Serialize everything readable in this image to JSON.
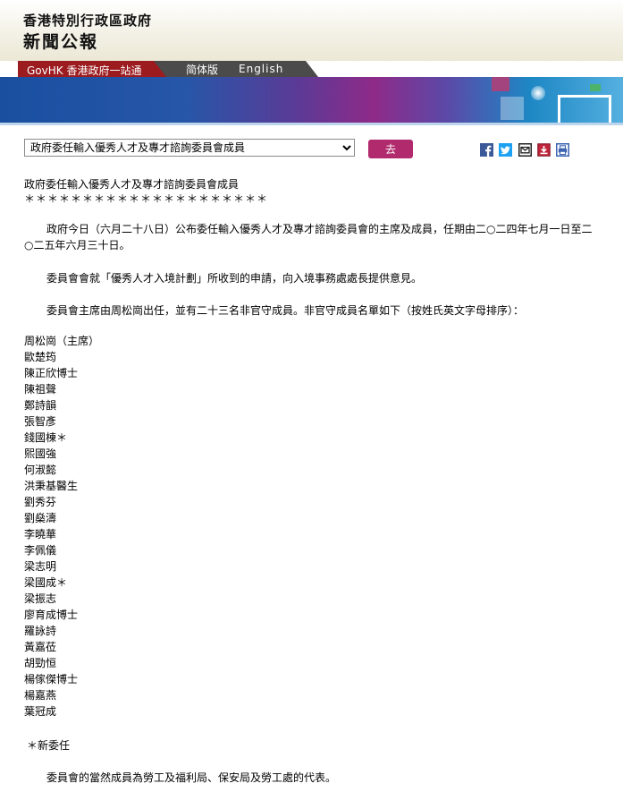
{
  "header": {
    "gov_name": "香港特別行政區政府",
    "press_name": "新聞公報"
  },
  "nav": {
    "govhk": "GovHK 香港政府一站通",
    "simplified": "简体版",
    "english": "English"
  },
  "selector": {
    "selected": "政府委任輸入優秀人才及專才諮詢委員會成員",
    "go_label": "去"
  },
  "share_icons": [
    "facebook-icon",
    "twitter-icon",
    "email-icon",
    "save-icon",
    "print-icon"
  ],
  "colors": {
    "govhk_red": "#9b1b1f",
    "lang_gray": "#4b4b4b",
    "go_button": "#b22a6e",
    "facebook": "#3b5998",
    "twitter": "#1da1f2",
    "save": "#c0243a",
    "print": "#3a63b0"
  },
  "article": {
    "title": "政府委任輸入優秀人才及專才諮詢委員會成員",
    "stars": "＊＊＊＊＊＊＊＊＊＊＊＊＊＊＊＊＊＊＊＊＊",
    "para1": "政府今日（六月二十八日）公布委任輸入優秀人才及專才諮詢委員會的主席及成員，任期由二○二四年七月一日至二○二五年六月三十日。",
    "para2": "委員會會就「優秀人才入境計劃」所收到的申請，向入境事務處處長提供意見。",
    "para3": "委員會主席由周松崗出任，並有二十三名非官守成員。非官守成員名單如下（按姓氏英文字母排序）：",
    "members": [
      "周松崗（主席）",
      "歐楚筠",
      "陳正欣博士",
      "陳祖聲",
      "鄭詩韻",
      "張智彥",
      "錢國棟＊",
      "熙國強",
      "何淑懿",
      "洪秉基醫生",
      "劉秀芬",
      "劉燊濤",
      "李曉華",
      "李佩儀",
      "梁志明",
      "梁國成＊",
      "梁振志",
      "廖育成博士",
      "羅詠詩",
      "黃嘉莅",
      "胡勁恒",
      "楊傢傑博士",
      "楊嘉燕",
      "葉冠成"
    ],
    "footnote": "＊新委任",
    "para4": "委員會的當然成員為勞工及福利局、保安局及勞工處的代表。"
  }
}
